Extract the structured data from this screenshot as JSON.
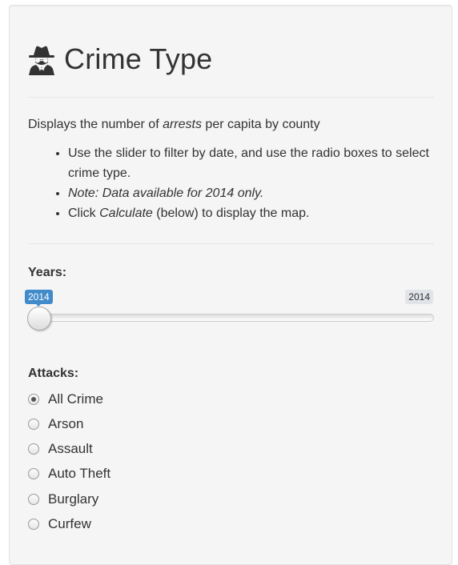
{
  "panel": {
    "title": "Crime Type",
    "icon": "user-secret-icon",
    "description": {
      "prefix": "Displays the number of ",
      "emphasis": "arrests",
      "suffix": " per capita by county"
    },
    "bullets": [
      {
        "text": "Use the slider to filter by date, and use the radio boxes to select crime type."
      },
      {
        "note": "Note: Data available for 2014 only."
      },
      {
        "prefix": "Click ",
        "emphasis": "Calculate",
        "suffix": " (below) to display the map."
      }
    ]
  },
  "years": {
    "label": "Years:",
    "value": "2014",
    "max": "2014"
  },
  "attacks": {
    "label": "Attacks:",
    "selected": "All Crime",
    "options": [
      "All Crime",
      "Arson",
      "Assault",
      "Auto Theft",
      "Burglary",
      "Curfew"
    ]
  },
  "colors": {
    "accent": "#428bca",
    "panel_bg": "#f5f5f5",
    "text": "#333333"
  }
}
